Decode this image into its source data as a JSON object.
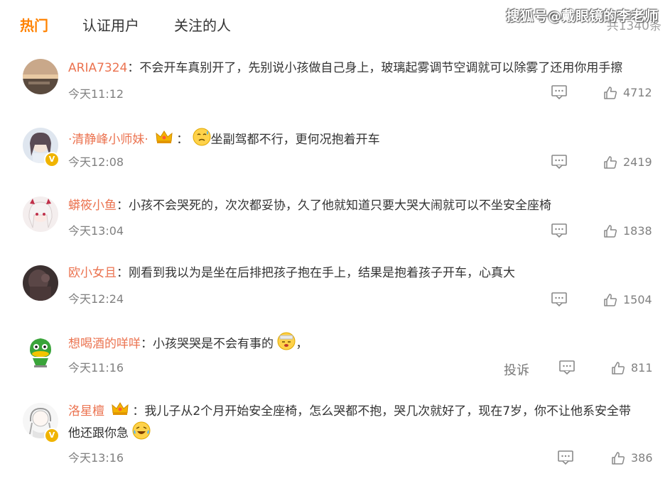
{
  "tabs": [
    {
      "label": "热门",
      "active": true
    },
    {
      "label": "认证用户",
      "active": false
    },
    {
      "label": "关注的人",
      "active": false
    }
  ],
  "total_count": "共1340条",
  "watermark": "搜狐号@戴眼镜的李老师",
  "colors": {
    "accent": "#ff8200",
    "username": "#eb7350",
    "meta": "#808080"
  },
  "comments": [
    {
      "user": "ARIA7324",
      "sep": "：",
      "text": "不会开车真别开了，先别说小孩做自己身上，玻璃起雾调节空调就可以除雾了还用你用手擦",
      "time": "今天11:12",
      "likes": "4712",
      "avatar_icon": "sunset-lake-avatar"
    },
    {
      "user": "·清静峰小师妹·",
      "sep": "：",
      "text": "坐副驾都不行，更何况抱着开车",
      "time": "今天12:08",
      "likes": "2419",
      "avatar_icon": "anime-girl-avatar",
      "badge": "crown-icon",
      "emoji": "sweat-emoji"
    },
    {
      "user": "蟒筱小鱼",
      "sep": "：",
      "text": "小孩不会哭死的，次次都妥协，久了他就知道只要大哭大闹就可以不坐安全座椅",
      "time": "今天13:04",
      "likes": "1838",
      "avatar_icon": "anime-white-hair-avatar"
    },
    {
      "user": "欧小女且",
      "sep": "：",
      "text": "刚看到我以为是坐在后排把孩子抱在手上，结果是抱着孩子开车，心真大",
      "time": "今天12:24",
      "likes": "1504",
      "avatar_icon": "dark-photo-avatar"
    },
    {
      "user": "想喝酒的咩咩",
      "sep": "：",
      "text": "小孩哭哭是不会有事的",
      "text_after": "，",
      "time": "今天11:16",
      "likes": "811",
      "avatar_icon": "green-duck-avatar",
      "emoji": "sick-emoji",
      "report": "投诉"
    },
    {
      "user": "洛星檀",
      "sep": "：",
      "text": "我儿子从2个月开始安全座椅，怎么哭都不抱，哭几次就好了，现在7岁，你不让他系安全带",
      "text_line2": "他还跟你急",
      "time": "今天13:16",
      "likes": "386",
      "avatar_icon": "sketch-girl-avatar",
      "badge": "crown-icon",
      "emoji": "laugh-cry-emoji"
    }
  ]
}
